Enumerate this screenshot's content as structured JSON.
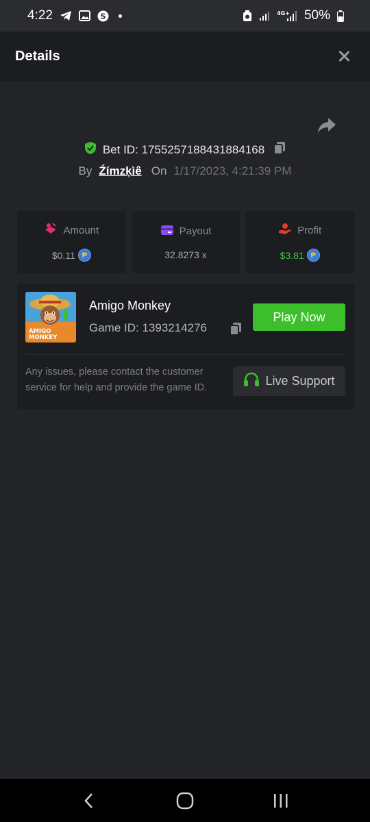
{
  "status_bar": {
    "time": "4:22",
    "battery": "50%"
  },
  "header": {
    "title": "Details"
  },
  "bet": {
    "id_label": "Bet ID: 1755257188431884168",
    "by_label": "By",
    "user": "Źímzķìê",
    "on_label": "On",
    "date": "1/17/2023, 4:21:39 PM"
  },
  "stats": {
    "amount": {
      "label": "Amount",
      "value": "$0.11",
      "icon": "amount-icon"
    },
    "payout": {
      "label": "Payout",
      "value": "32.8273 x",
      "icon": "card-icon"
    },
    "profit": {
      "label": "Profit",
      "value": "$3.81",
      "icon": "profit-hand-icon"
    },
    "coin_symbol": "₱"
  },
  "game": {
    "name": "Amigo Monkey",
    "id_label": "Game ID: 1393214276",
    "thumb_text_1": "AMIGO",
    "thumb_text_2": "MONKEY",
    "play_label": "Play Now"
  },
  "support": {
    "help_text": "Any issues, please contact the customer service for help and provide the game ID.",
    "button_label": "Live Support"
  },
  "colors": {
    "accent_green": "#3cbf2b",
    "profit_green": "#3ec93a",
    "amount_pink": "#e0316a",
    "payout_purple": "#8b4cf0",
    "profit_red": "#e23b2e"
  }
}
